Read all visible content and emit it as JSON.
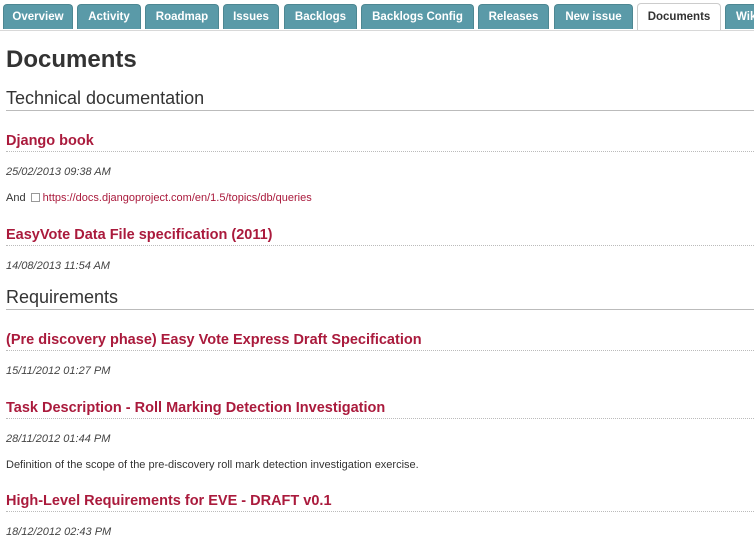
{
  "tabs": [
    {
      "label": "Overview"
    },
    {
      "label": "Activity"
    },
    {
      "label": "Roadmap"
    },
    {
      "label": "Issues"
    },
    {
      "label": "Backlogs"
    },
    {
      "label": "Backlogs Config"
    },
    {
      "label": "Releases"
    },
    {
      "label": "New issue"
    },
    {
      "label": "Documents",
      "selected": true
    },
    {
      "label": "Wiki"
    }
  ],
  "page": {
    "title": "Documents"
  },
  "categories": [
    {
      "name": "Technical documentation",
      "documents": [
        {
          "title": "Django book",
          "date": "25/02/2013 09:38 AM",
          "desc_prefix": "And",
          "link": "https://docs.djangoproject.com/en/1.5/topics/db/queries"
        },
        {
          "title": "EasyVote Data File specification (2011)",
          "date": "14/08/2013 11:54 AM"
        }
      ]
    },
    {
      "name": "Requirements",
      "documents": [
        {
          "title": "(Pre discovery phase) Easy Vote Express Draft Specification",
          "date": "15/11/2012 01:27 PM"
        },
        {
          "title": "Task Description - Roll Marking Detection Investigation",
          "date": "28/11/2012 01:44 PM",
          "description": "Definition of the scope of the pre-discovery roll mark detection investigation exercise."
        },
        {
          "title": "High-Level Requirements for EVE - DRAFT v0.1",
          "date": "18/12/2012 02:43 PM"
        }
      ]
    }
  ],
  "colors": {
    "tab_bg": "#5a9aa8",
    "link": "#aa1a3c",
    "text": "#333333"
  }
}
